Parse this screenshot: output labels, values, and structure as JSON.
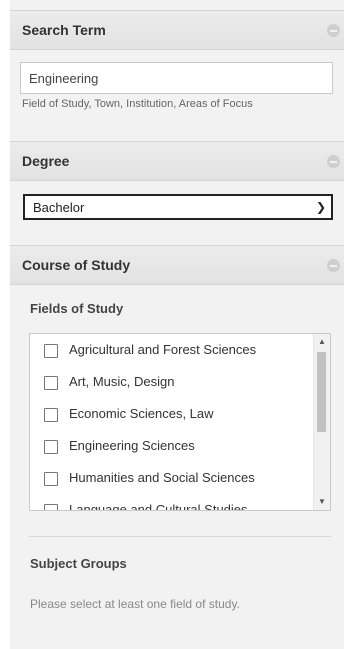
{
  "search_section": {
    "title": "Search Term",
    "input_value": "Engineering",
    "hint": "Field of Study, Town, Institution, Areas of Focus"
  },
  "degree_section": {
    "title": "Degree",
    "selected": "Bachelor"
  },
  "course_section": {
    "title": "Course of Study",
    "fields_heading": "Fields of Study",
    "fields": [
      {
        "label": "Agricultural and Forest Sciences",
        "checked": false
      },
      {
        "label": "Art, Music, Design",
        "checked": false
      },
      {
        "label": "Economic Sciences, Law",
        "checked": false
      },
      {
        "label": "Engineering Sciences",
        "checked": false
      },
      {
        "label": "Humanities and Social Sciences",
        "checked": false
      },
      {
        "label": "Language and Cultural Studies",
        "checked": false
      }
    ],
    "subject_groups_heading": "Subject Groups",
    "subject_groups_note": "Please select at least one field of study."
  },
  "icons": {
    "collapse": "minus-circle-icon",
    "select_arrow": "chevron-down-icon",
    "scroll_up": "triangle-up-icon",
    "scroll_down": "triangle-down-icon"
  }
}
